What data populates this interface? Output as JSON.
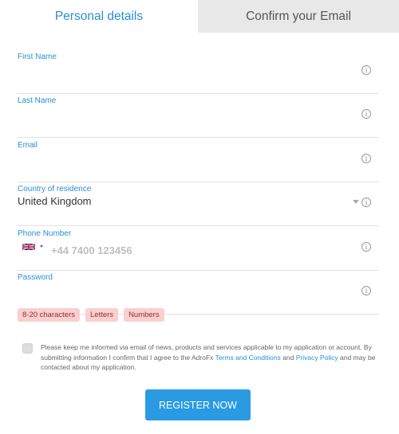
{
  "tabs": [
    {
      "label": "Personal details",
      "active": true
    },
    {
      "label": "Confirm your Email",
      "active": false
    }
  ],
  "form": {
    "first_name": {
      "label": "First Name",
      "value": ""
    },
    "last_name": {
      "label": "Last Name",
      "value": ""
    },
    "email": {
      "label": "Email",
      "value": ""
    },
    "country": {
      "label": "Country of residence",
      "value": "United Kingdom"
    },
    "phone": {
      "label": "Phone Number",
      "country_flag": "uk-flag",
      "placeholder": "+44 7400 123456",
      "value": ""
    },
    "password": {
      "label": "Password",
      "value": ""
    }
  },
  "password_requirements": [
    "8-20 characters",
    "Letters",
    "Numbers"
  ],
  "consent": {
    "checked": false,
    "text_before": "Please keep me informed via email of news, products and services applicable to my application or account. By submitting information I confirm that I agree to the AdroFx ",
    "terms_link": "Terms and Conditions",
    "text_middle": " and ",
    "privacy_link": "Privacy Policy",
    "text_after": " and may be contacted about my application."
  },
  "register_button": "REGISTER NOW",
  "icons": {
    "info": "info-icon",
    "dropdown": "caret-down-icon",
    "flag": "uk-flag-icon"
  },
  "colors": {
    "accent": "#2a8fd6",
    "button": "#2a9be3",
    "requirement_bg": "#f9cfd0"
  }
}
